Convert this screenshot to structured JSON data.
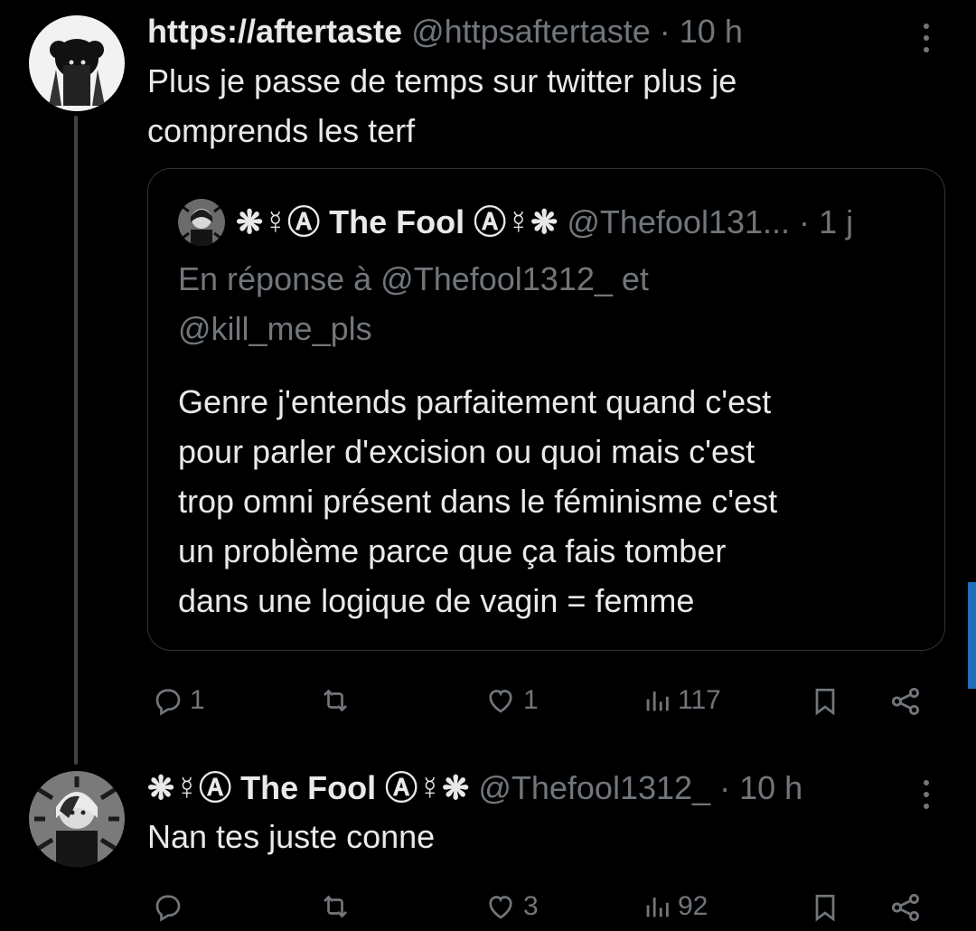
{
  "tweet1": {
    "display_name": "https://aftertaste",
    "handle": "@httpsaftertaste",
    "time": "10 h",
    "text_line1": "Plus je passe de temps sur twitter plus je",
    "text_line2": "comprends les terf"
  },
  "quote": {
    "display_name": "❋☿Ⓐ The Fool Ⓐ☿❋",
    "handle": "@Thefool131...",
    "time": "1 j",
    "reply_line1": "En réponse à @Thefool1312_ et",
    "reply_line2": "@kill_me_pls",
    "text_lines": [
      "Genre j'entends parfaitement quand c'est",
      "pour parler d'excision ou quoi mais c'est",
      "trop omni présent dans le féminisme c'est",
      "un problème parce que ça fais tomber",
      "dans une logique de vagin = femme"
    ]
  },
  "tweet1_actions": {
    "replies": "1",
    "retweets": "",
    "likes": "1",
    "views": "117"
  },
  "tweet2": {
    "display_name": "❋☿Ⓐ The Fool Ⓐ☿❋",
    "handle": "@Thefool1312_",
    "time": "10 h",
    "text": "Nan tes juste conne"
  },
  "tweet2_actions": {
    "replies": "",
    "retweets": "",
    "likes": "3",
    "views": "92"
  },
  "separator": "·",
  "icons": [
    "reply-icon",
    "retweet-icon",
    "like-icon",
    "views-icon",
    "bookmark-icon",
    "share-icon",
    "more-icon"
  ],
  "colors": {
    "background": "#000000",
    "text": "#e7e9ea",
    "muted": "#71767b",
    "border": "#2f3336",
    "accent": "#1d6fb8"
  }
}
